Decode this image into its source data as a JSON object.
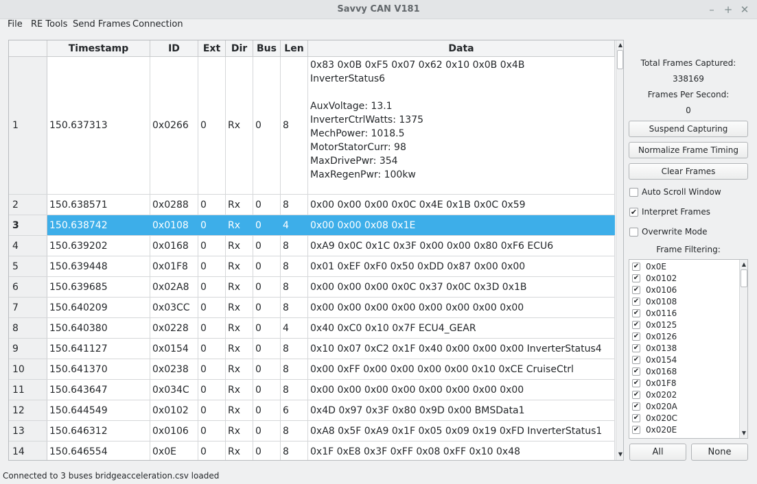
{
  "window": {
    "title": "Savvy CAN V181",
    "minimize_glyph": "–",
    "maximize_glyph": "+",
    "close_glyph": "✕"
  },
  "menu": [
    "File",
    "RE Tools",
    "Send Frames",
    "Connection"
  ],
  "table": {
    "headers": [
      "Timestamp",
      "ID",
      "Ext",
      "Dir",
      "Bus",
      "Len",
      "Data"
    ],
    "selected_row": 3,
    "rows": [
      {
        "num": "1",
        "ts": "150.637313",
        "id": "0x0266",
        "ext": "0",
        "dir": "Rx",
        "bus": "0",
        "len": "8",
        "data_lines": [
          "0x83 0x0B 0xF5 0x07 0x62 0x10 0x0B 0x4B",
          "InverterStatus6",
          "",
          "AuxVoltage: 13.1",
          "InverterCtrlWatts: 1375",
          "MechPower: 1018.5",
          "MotorStatorCurr: 98",
          "MaxDrivePwr: 354",
          "MaxRegenPwr: 100kw"
        ]
      },
      {
        "num": "2",
        "ts": "150.638571",
        "id": "0x0288",
        "ext": "0",
        "dir": "Rx",
        "bus": "0",
        "len": "8",
        "data": "0x00 0x00 0x00 0x0C 0x4E 0x1B 0x0C 0x59"
      },
      {
        "num": "3",
        "ts": "150.638742",
        "id": "0x0108",
        "ext": "0",
        "dir": "Rx",
        "bus": "0",
        "len": "4",
        "data": "0x00 0x00 0x08 0x1E"
      },
      {
        "num": "4",
        "ts": "150.639202",
        "id": "0x0168",
        "ext": "0",
        "dir": "Rx",
        "bus": "0",
        "len": "8",
        "data": "0xA9 0x0C 0x1C 0x3F 0x00 0x00 0x80 0xF6 ECU6"
      },
      {
        "num": "5",
        "ts": "150.639448",
        "id": "0x01F8",
        "ext": "0",
        "dir": "Rx",
        "bus": "0",
        "len": "8",
        "data": "0x01 0xEF 0xF0 0x50 0xDD 0x87 0x00 0x00"
      },
      {
        "num": "6",
        "ts": "150.639685",
        "id": "0x02A8",
        "ext": "0",
        "dir": "Rx",
        "bus": "0",
        "len": "8",
        "data": "0x00 0x00 0x00 0x0C 0x37 0x0C 0x3D 0x1B"
      },
      {
        "num": "7",
        "ts": "150.640209",
        "id": "0x03CC",
        "ext": "0",
        "dir": "Rx",
        "bus": "0",
        "len": "8",
        "data": "0x00 0x00 0x00 0x00 0x00 0x00 0x00 0x00"
      },
      {
        "num": "8",
        "ts": "150.640380",
        "id": "0x0228",
        "ext": "0",
        "dir": "Rx",
        "bus": "0",
        "len": "4",
        "data": "0x40 0xC0 0x10 0x7F ECU4_GEAR"
      },
      {
        "num": "9",
        "ts": "150.641127",
        "id": "0x0154",
        "ext": "0",
        "dir": "Rx",
        "bus": "0",
        "len": "8",
        "data": "0x10 0x07 0xC2 0x1F 0x40 0x00 0x00 0x00 InverterStatus4"
      },
      {
        "num": "10",
        "ts": "150.641370",
        "id": "0x0238",
        "ext": "0",
        "dir": "Rx",
        "bus": "0",
        "len": "8",
        "data": "0x00 0xFF 0x00 0x00 0x00 0x00 0x10 0xCE CruiseCtrl"
      },
      {
        "num": "11",
        "ts": "150.643647",
        "id": "0x034C",
        "ext": "0",
        "dir": "Rx",
        "bus": "0",
        "len": "8",
        "data": "0x00 0x00 0x00 0x00 0x00 0x00 0x00 0x00"
      },
      {
        "num": "12",
        "ts": "150.644549",
        "id": "0x0102",
        "ext": "0",
        "dir": "Rx",
        "bus": "0",
        "len": "6",
        "data": "0x4D 0x97 0x3F 0x80 0x9D 0x00 BMSData1"
      },
      {
        "num": "13",
        "ts": "150.646312",
        "id": "0x0106",
        "ext": "0",
        "dir": "Rx",
        "bus": "0",
        "len": "8",
        "data": "0xA8 0x5F 0xA9 0x1F 0x05 0x09 0x19 0xFD InverterStatus1"
      },
      {
        "num": "14",
        "ts": "150.646554",
        "id": "0x0E",
        "ext": "0",
        "dir": "Rx",
        "bus": "0",
        "len": "8",
        "data": "0x1F 0xE8 0x3F 0xFF 0x08 0xFF 0x10 0x48"
      }
    ]
  },
  "panel": {
    "total_frames_label": "Total Frames Captured:",
    "total_frames_value": "338169",
    "fps_label": "Frames Per Second:",
    "fps_value": "0",
    "suspend_label": "Suspend Capturing",
    "normalize_label": "Normalize Frame Timing",
    "clear_label": "Clear Frames",
    "auto_scroll_label": "Auto Scroll Window",
    "auto_scroll_checked": false,
    "interpret_label": "Interpret Frames",
    "interpret_checked": true,
    "overwrite_label": "Overwrite Mode",
    "overwrite_checked": false,
    "filter_label": "Frame Filtering:",
    "filters": [
      {
        "id": "0x0E",
        "checked": true
      },
      {
        "id": "0x0102",
        "checked": true
      },
      {
        "id": "0x0106",
        "checked": true
      },
      {
        "id": "0x0108",
        "checked": true
      },
      {
        "id": "0x0116",
        "checked": true
      },
      {
        "id": "0x0125",
        "checked": true
      },
      {
        "id": "0x0126",
        "checked": true
      },
      {
        "id": "0x0138",
        "checked": true
      },
      {
        "id": "0x0154",
        "checked": true
      },
      {
        "id": "0x0168",
        "checked": true
      },
      {
        "id": "0x01F8",
        "checked": true
      },
      {
        "id": "0x0202",
        "checked": true
      },
      {
        "id": "0x020A",
        "checked": true
      },
      {
        "id": "0x020C",
        "checked": true
      },
      {
        "id": "0x020E",
        "checked": true
      }
    ],
    "all_label": "All",
    "none_label": "None"
  },
  "status": "Connected to 3 buses  bridgeacceleration.csv loaded",
  "colors": {
    "selection": "#3daee9",
    "window_bg": "#eff0f1"
  }
}
